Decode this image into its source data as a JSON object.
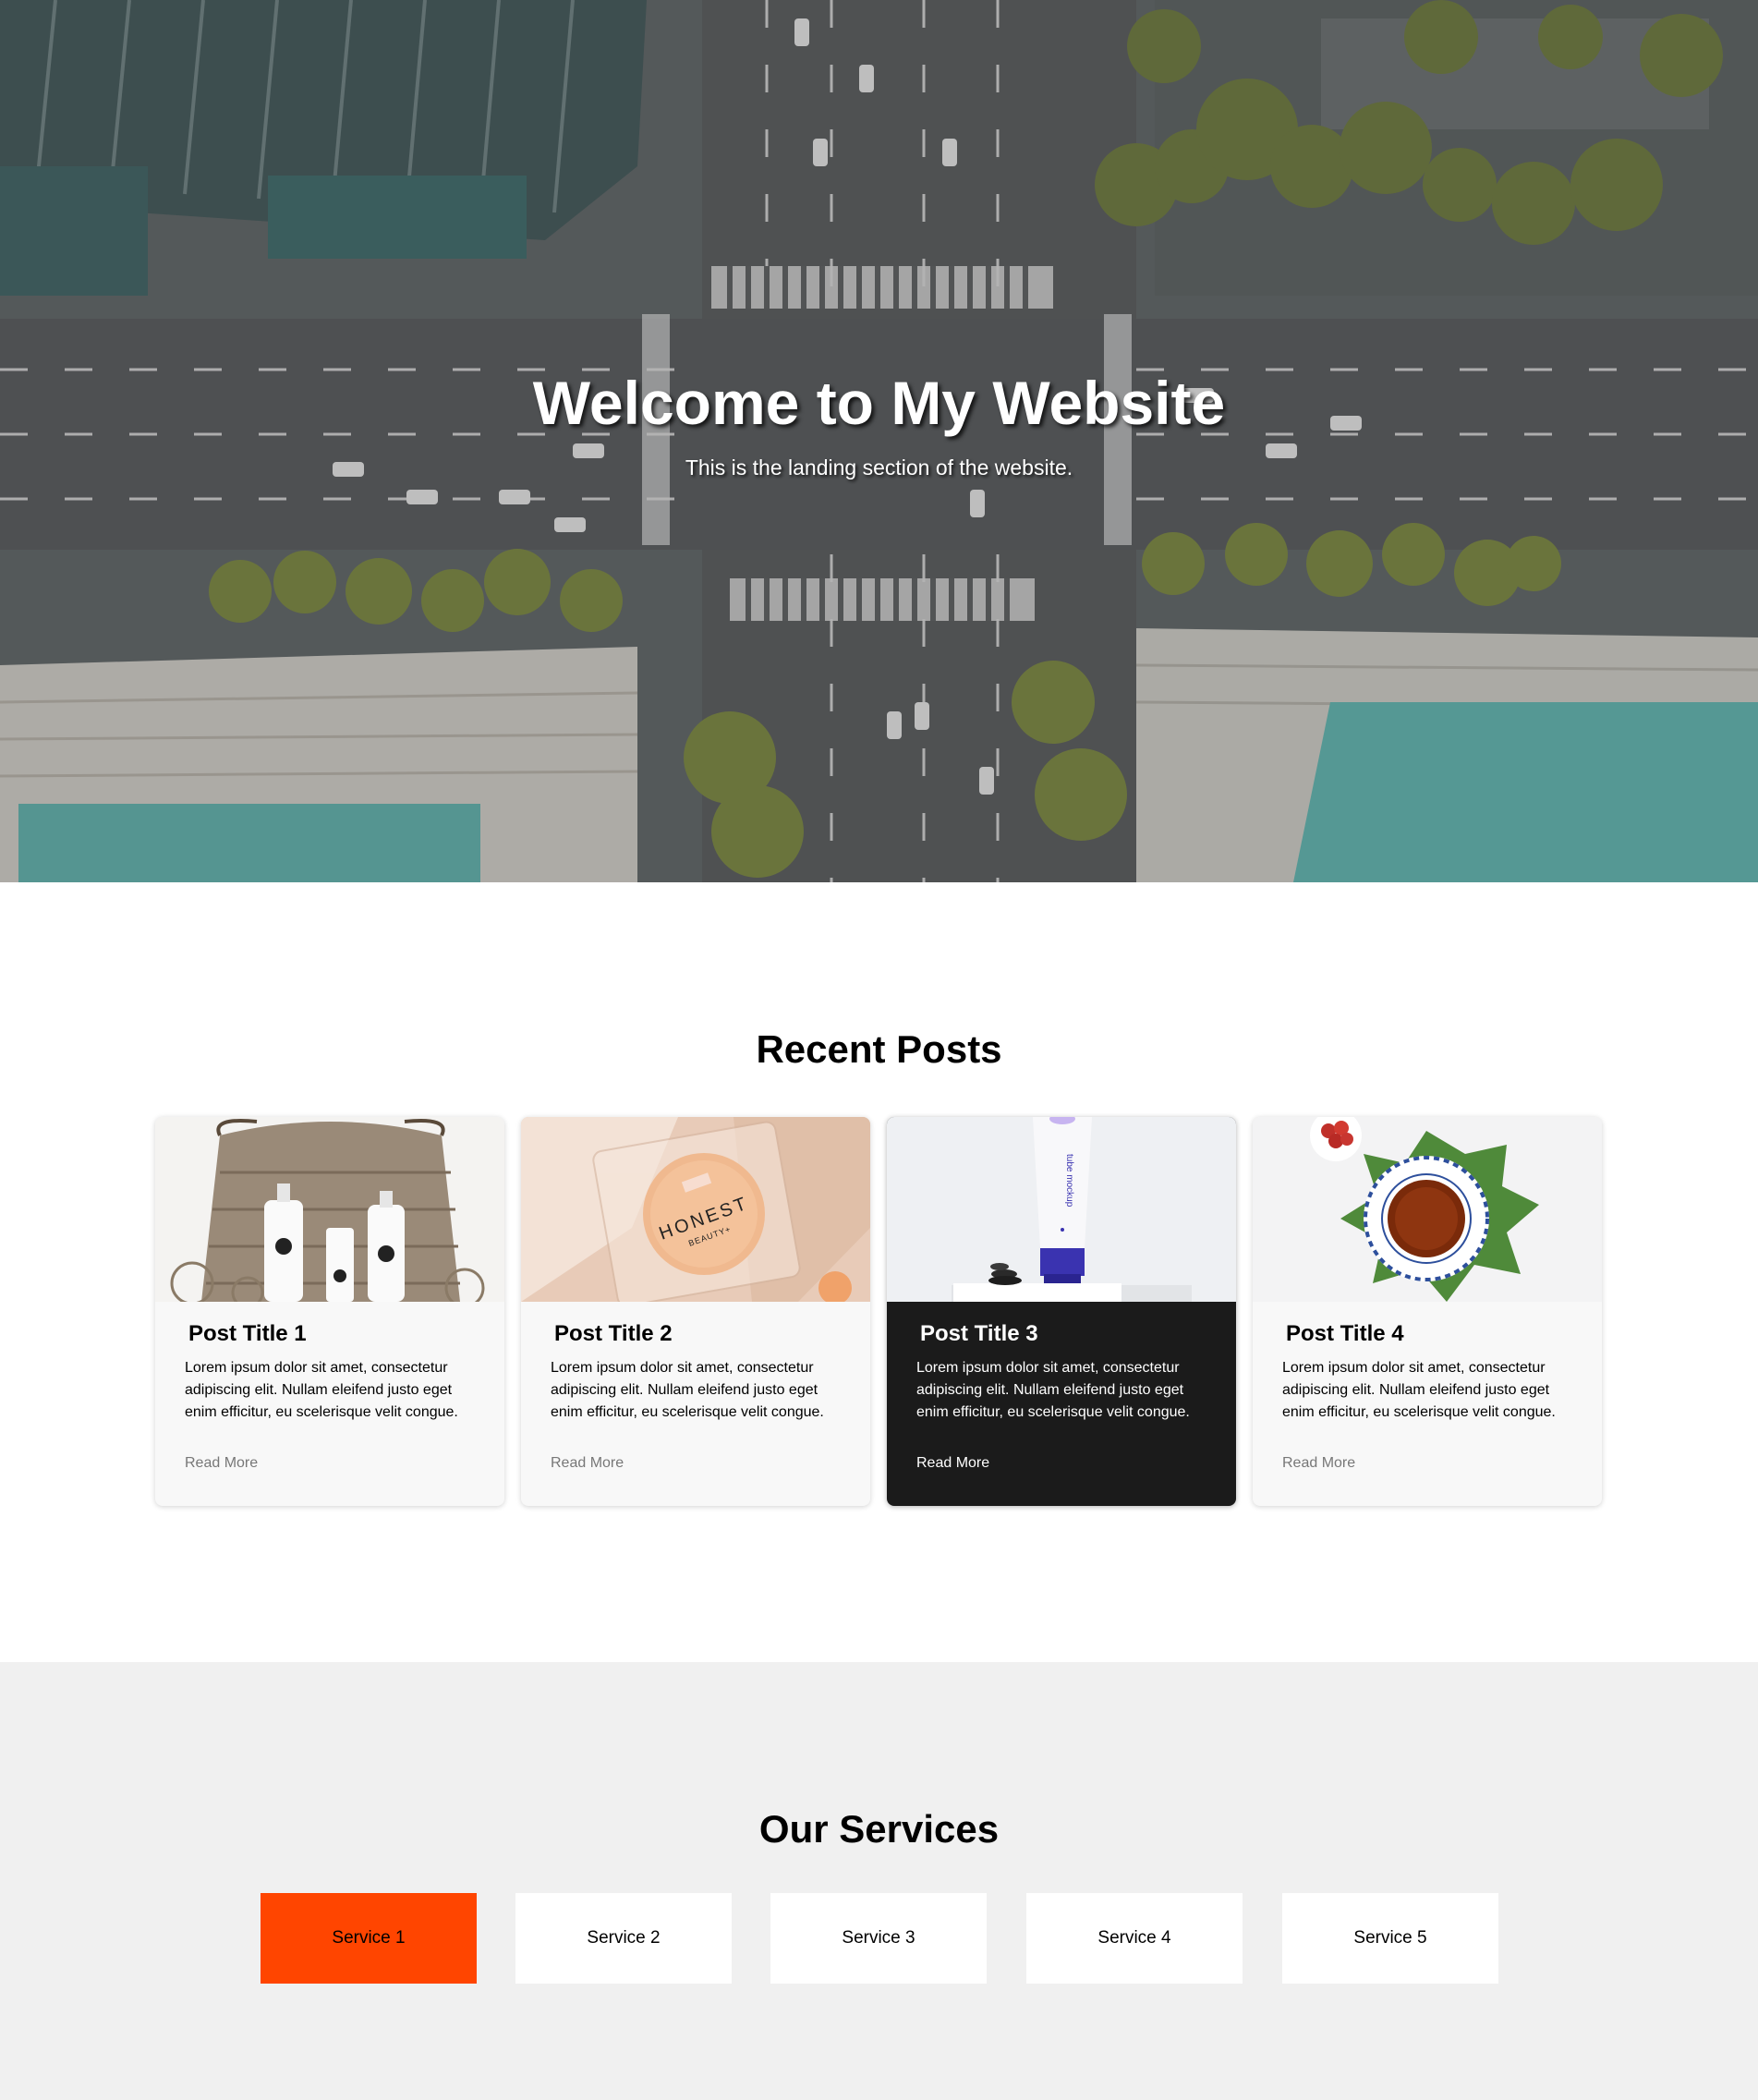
{
  "hero": {
    "title": "Welcome to My Website",
    "subtitle": "This is the landing section of the website."
  },
  "posts": {
    "heading": "Recent Posts",
    "items": [
      {
        "title": "Post Title 1",
        "excerpt": "Lorem ipsum dolor sit amet, consectetur adipiscing elit. Nullam eleifend justo eget enim efficitur, eu scelerisque velit congue.",
        "link": "Read More",
        "image": "skincare-bottles-basket-image"
      },
      {
        "title": "Post Title 2",
        "excerpt": "Lorem ipsum dolor sit amet, consectetur adipiscing elit. Nullam eleifend justo eget enim efficitur, eu scelerisque velit congue.",
        "link": "Read More",
        "image": "honest-beauty-compact-image",
        "image_text": "HONEST",
        "image_subtext": "BEAUTY+"
      },
      {
        "title": "Post Title 3",
        "excerpt": "Lorem ipsum dolor sit amet, consectetur adipiscing elit. Nullam eleifend justo eget enim efficitur, eu scelerisque velit congue.",
        "link": "Read More",
        "image": "tube-mockup-image",
        "image_text": "tube mockup"
      },
      {
        "title": "Post Title 4",
        "excerpt": "Lorem ipsum dolor sit amet, consectetur adipiscing elit. Nullam eleifend justo eget enim efficitur, eu scelerisque velit congue.",
        "link": "Read More",
        "image": "tea-cup-leaf-image"
      }
    ]
  },
  "services": {
    "heading": "Our Services",
    "items": [
      "Service 1",
      "Service 2",
      "Service 3",
      "Service 4",
      "Service 5"
    ]
  },
  "colors": {
    "accent": "#ff4500",
    "dark_card": "#1b1b1b",
    "services_bg": "#f0f0f0"
  }
}
